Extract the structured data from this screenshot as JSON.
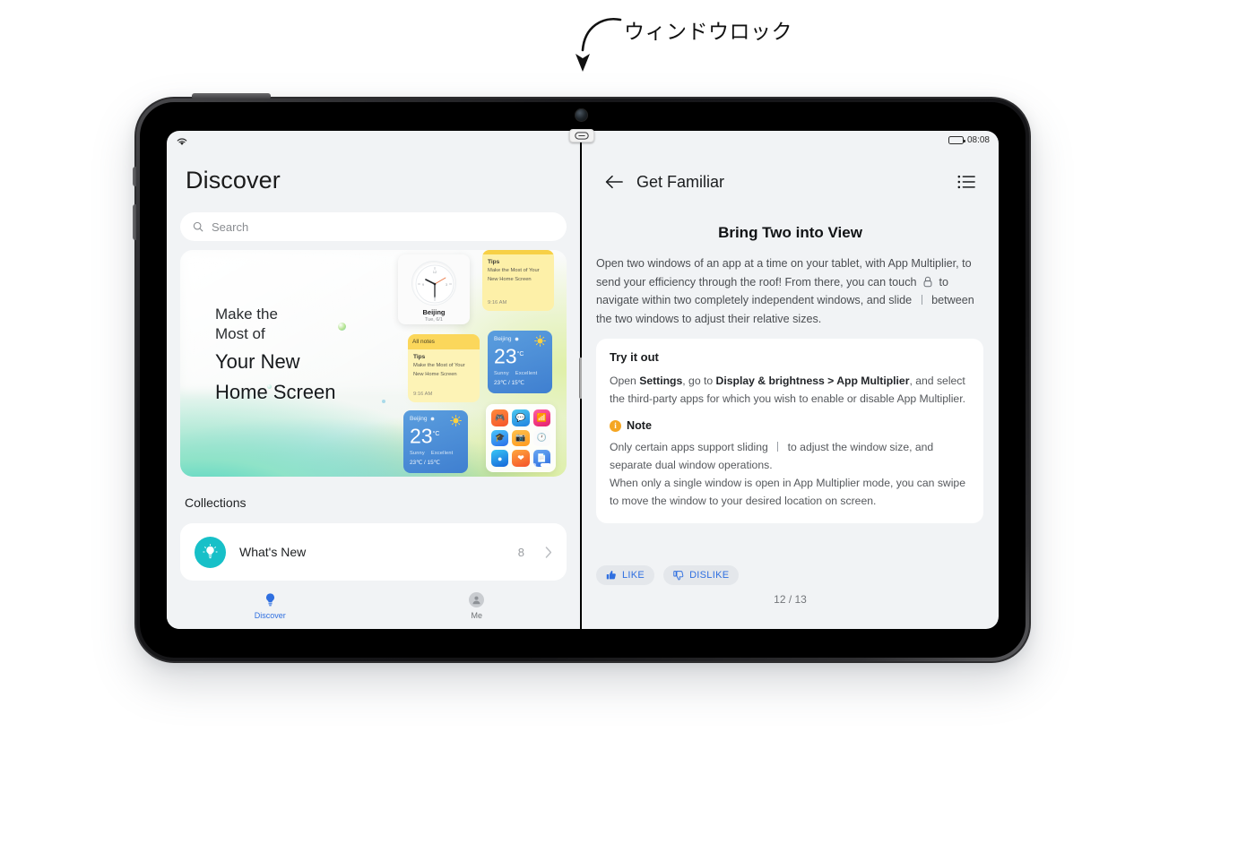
{
  "annotation": {
    "label": "ウィンドウロック",
    "arrow": "curved-down-arrow"
  },
  "device": {
    "name": "tablet",
    "camera_icon": "front-camera",
    "buttons": [
      "power-button",
      "volume-up-button",
      "volume-down-button"
    ]
  },
  "divider": {
    "badge_icon": "window-lock-link-icon",
    "handle": "split-screen-drag-handle"
  },
  "status_bar": {
    "wifi_icon": "wifi-icon",
    "battery_icon": "battery-icon",
    "time": "08:08"
  },
  "left_pane": {
    "title": "Discover",
    "search": {
      "icon": "search-icon",
      "placeholder": "Search"
    },
    "banner": {
      "line1": "Make the",
      "line2": "Most of",
      "line3": "Your New",
      "line4": "Home Screen",
      "dots": 2,
      "active_dot": 2,
      "widgets": {
        "clock": {
          "city": "Beijing",
          "date": "Tue, 6/1"
        },
        "tips_top": {
          "title": "Tips",
          "line1": "Make the Most of Your",
          "line2": "New Home Screen",
          "time": "9:16 AM"
        },
        "notes": {
          "header": "All notes",
          "title": "Tips",
          "line1": "Make the Most of Your",
          "line2": "New Home Screen",
          "time": "9:16 AM"
        },
        "weather": {
          "city": "Beijing",
          "temp": "23",
          "unit": "°C",
          "condition": "Sunny",
          "quality": "Excellent",
          "range": "23℃ / 15℃",
          "icon": "sun-icon"
        },
        "app_grid_icons": [
          "game-icon",
          "messages-icon",
          "radio-icon",
          "education-icon",
          "gallery-icon",
          "clock-icon",
          "music-icon",
          "health-icon",
          "notes-icon"
        ]
      }
    },
    "collections": {
      "heading": "Collections",
      "items": [
        {
          "icon": "lightbulb-icon",
          "icon_color": "#17c0c8",
          "label": "What's New",
          "count": "8",
          "chevron": "chevron-right-icon"
        }
      ]
    },
    "tabbar": [
      {
        "icon": "lightbulb-icon",
        "label": "Discover",
        "active": true
      },
      {
        "icon": "person-icon",
        "label": "Me",
        "active": false
      }
    ]
  },
  "right_pane": {
    "header": {
      "back_icon": "back-arrow-icon",
      "title": "Get Familiar",
      "menu_icon": "list-menu-icon"
    },
    "article": {
      "heading": "Bring Two into View",
      "body_part1": "Open two windows of an app at a time on your tablet, with App Multiplier, to send your efficiency through the roof! From there, you can touch",
      "body_part2": "to navigate within two completely independent windows, and slide",
      "body_part3": "between the two windows to adjust their relative sizes.",
      "inline_lock_icon": "window-lock-icon",
      "inline_slider_icon": "divider-slider-icon"
    },
    "try_it_out": {
      "title": "Try it out",
      "text_pre": "Open ",
      "bold1": "Settings",
      "text_mid": ", go to ",
      "bold2": "Display & brightness > App Multiplier",
      "text_post": ", and select the third-party apps for which you wish to enable or disable App Multiplier.",
      "note": {
        "icon": "info-icon",
        "icon_color": "#f5a623",
        "label": "Note",
        "line1_pre": "Only certain apps support sliding",
        "line1_post": "to adjust the window size, and separate dual window operations.",
        "line2": "When only a single window is open in App Multiplier mode, you can swipe to move the window to your desired location on screen."
      }
    },
    "feedback": {
      "like": {
        "icon": "thumbs-up-icon",
        "label": "LIKE"
      },
      "dislike": {
        "icon": "thumbs-down-icon",
        "label": "DISLIKE"
      }
    },
    "page_counter": "12 / 13"
  },
  "colors": {
    "accent_blue": "#2f6fe0",
    "teal": "#17c0c8",
    "orange": "#f5a623",
    "pane_bg": "#f1f3f5"
  }
}
